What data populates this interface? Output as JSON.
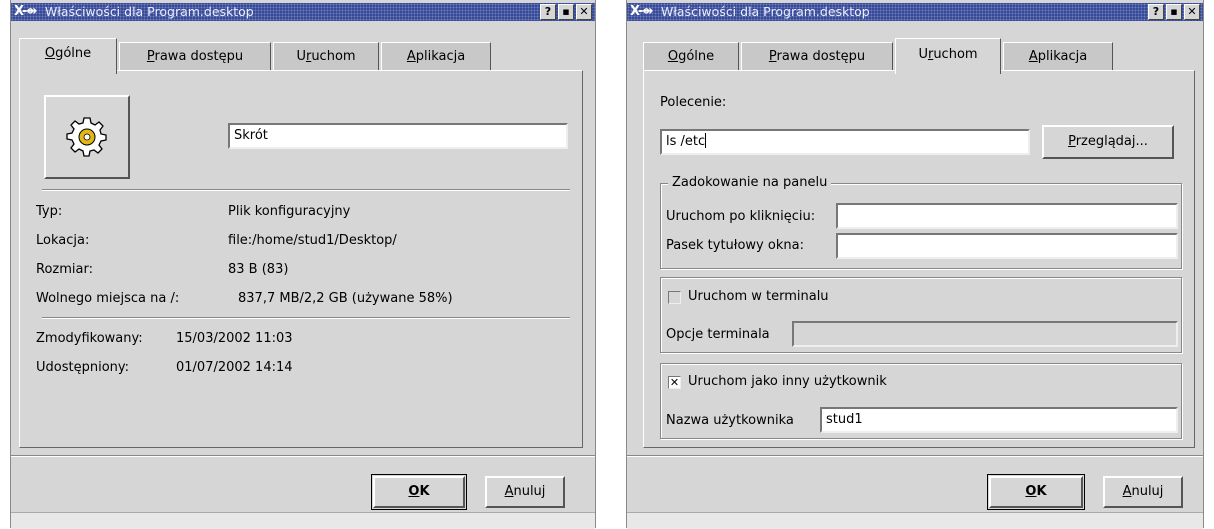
{
  "left": {
    "title": "Właściwości dla Program.desktop",
    "title_icon": "X-⇴",
    "tabs": [
      {
        "label_u": "O",
        "label_rest": "gólne"
      },
      {
        "label_u": "P",
        "label_rest": "rawa dostępu"
      },
      {
        "label_pre": "U",
        "label_u": "r",
        "label_rest": "uchom"
      },
      {
        "label_u": "A",
        "label_rest": "plikacja"
      }
    ],
    "name_value": "Skrót",
    "info": [
      {
        "label": "Typ:",
        "value": "Plik konfiguracyjny"
      },
      {
        "label": "Lokacja:",
        "value": "file:/home/stud1/Desktop/"
      },
      {
        "label": "Rozmiar:",
        "value": "83 B (83)"
      },
      {
        "label": "Wolnego miejsca na /:",
        "value": "837,7 MB/2,2 GB (używane 58%)"
      }
    ],
    "dates": [
      {
        "label": "Zmodyfikowany:",
        "value": "15/03/2002 11:03"
      },
      {
        "label": "Udostępniony:",
        "value": "01/07/2002 14:14"
      }
    ],
    "ok_u": "O",
    "ok_rest": "K",
    "cancel_u": "A",
    "cancel_rest": "nuluj"
  },
  "right": {
    "title": "Właściwości dla Program.desktop",
    "title_icon": "X-⇴",
    "tabs": [
      {
        "label_u": "O",
        "label_rest": "gólne"
      },
      {
        "label_u": "P",
        "label_rest": "rawa dostępu"
      },
      {
        "label_pre": "U",
        "label_u": "r",
        "label_rest": "uchom"
      },
      {
        "label_u": "A",
        "label_rest": "plikacja"
      }
    ],
    "command_label": "Polecenie:",
    "command_value": "ls /etc",
    "browse_u": "P",
    "browse_rest": "rzeglądaj...",
    "panel_group_title": "Zadokowanie na panelu",
    "run_on_click_label": "Uruchom po kliknięciu:",
    "run_on_click_value": "",
    "window_title_label": "Pasek tytułowy okna:",
    "window_title_value": "",
    "terminal_checkbox_label": "Uruchom w terminalu",
    "terminal_checked": false,
    "terminal_options_label": "Opcje terminala",
    "terminal_options_value": "",
    "other_user_checkbox_label": "Uruchom jako inny użytkownik",
    "other_user_checked": true,
    "username_label": "Nazwa użytkownika",
    "username_value": "stud1",
    "ok_u": "O",
    "ok_rest": "K",
    "cancel_u": "A",
    "cancel_rest": "nuluj"
  },
  "titlebar_buttons": [
    "?",
    "▪",
    "✕"
  ]
}
